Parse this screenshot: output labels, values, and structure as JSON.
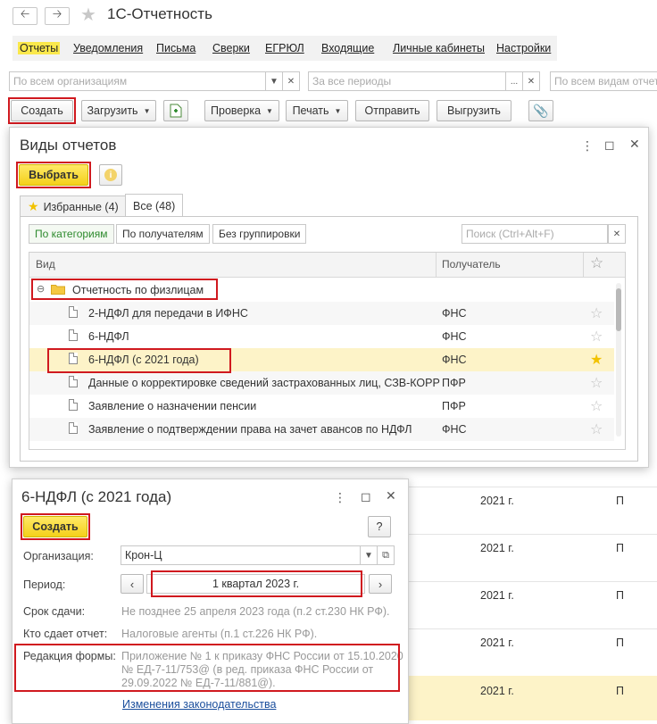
{
  "window": {
    "title": "1С-Отчетность"
  },
  "tabs": [
    {
      "label": "Отчеты",
      "active": true
    },
    {
      "label": "Уведомления"
    },
    {
      "label": "Письма"
    },
    {
      "label": "Сверки"
    },
    {
      "label": "ЕГРЮЛ"
    },
    {
      "label": "Входящие"
    },
    {
      "label": "Личные кабинеты"
    },
    {
      "label": "Настройки"
    }
  ],
  "filters": {
    "org_placeholder": "По всем организациям",
    "period_placeholder": "За все периоды",
    "type_placeholder": "По всем видам отчет"
  },
  "toolbar": {
    "create": "Создать",
    "load": "Загрузить",
    "check": "Проверка",
    "print": "Печать",
    "send": "Отправить",
    "unload": "Выгрузить"
  },
  "background_rows": [
    {
      "year": "2021 г.",
      "col": "П"
    },
    {
      "year": "2021 г.",
      "col": "П"
    },
    {
      "year": "2021 г.",
      "col": "П"
    },
    {
      "year": "2021 г.",
      "col": "П"
    },
    {
      "year": "2021 г.",
      "col": "П"
    }
  ],
  "report_types": {
    "title": "Виды отчетов",
    "select_btn": "Выбрать",
    "tabs": [
      "Избранные (4)",
      "Все (48)"
    ],
    "grouping": [
      "По категориям",
      "По получателям",
      "Без группировки"
    ],
    "search_placeholder": "Поиск (Ctrl+Alt+F)",
    "columns": {
      "kind": "Вид",
      "recipient": "Получатель"
    },
    "group": "Отчетность по физлицам",
    "rows": [
      {
        "name": "2-НДФЛ для передачи в ИФНС",
        "recipient": "ФНС",
        "fav": false
      },
      {
        "name": "6-НДФЛ",
        "recipient": "ФНС",
        "fav": false
      },
      {
        "name": "6-НДФЛ (с 2021 года)",
        "recipient": "ФНС",
        "fav": true
      },
      {
        "name": "Данные о корректировке сведений застрахованных лиц, СЗВ-КОРР",
        "recipient": "ПФР",
        "fav": false
      },
      {
        "name": "Заявление о назначении пенсии",
        "recipient": "ПФР",
        "fav": false
      },
      {
        "name": "Заявление о подтверждении права на зачет авансов по НДФЛ",
        "recipient": "ФНС",
        "fav": false
      }
    ]
  },
  "report_form": {
    "title": "6-НДФЛ (с 2021 года)",
    "create_btn": "Создать",
    "help": "?",
    "org_label": "Организация:",
    "org_value": "Крон-Ц",
    "period_label": "Период:",
    "period_value": "1 квартал 2023 г.",
    "deadline_label": "Срок сдачи:",
    "deadline_value": "Не позднее 25 апреля 2023 года (п.2 ст.230 НК РФ).",
    "submitter_label": "Кто сдает отчет:",
    "submitter_value": "Налоговые агенты (п.1 ст.226 НК РФ).",
    "edition_label": "Редакция формы:",
    "edition_lines": [
      "Приложение № 1 к приказу ФНС России от 15.10.2020",
      "№ ЕД-7-11/753@ (в ред. приказа ФНС России от",
      "29.09.2022 № ЕД-7-11/881@)."
    ],
    "law_link": "Изменения законодательства"
  }
}
